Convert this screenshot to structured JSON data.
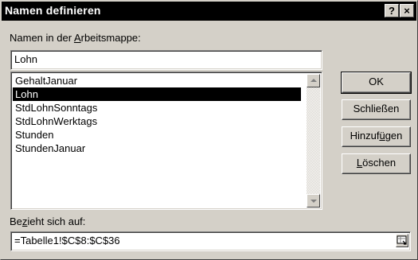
{
  "window": {
    "title": "Namen definieren",
    "help_button": "?",
    "close_button": "×"
  },
  "names_section": {
    "label_before": "Namen in der ",
    "label_accel": "A",
    "label_after": "rbeitsmappe:",
    "input_value": "Lohn",
    "items": [
      "GehaltJanuar",
      "Lohn",
      "StdLohnSonntags",
      "StdLohnWerktags",
      "Stunden",
      "StundenJanuar"
    ],
    "selected": "Lohn"
  },
  "buttons": {
    "ok": "OK",
    "close_before": "Schließen",
    "add_before": "Hinzuf",
    "add_accel": "ü",
    "add_after": "gen",
    "delete_accel": "L",
    "delete_after": "öschen"
  },
  "refers_section": {
    "label_before": "Be",
    "label_accel": "z",
    "label_after": "ieht sich auf:",
    "value": "=Tabelle1!$C$8:$C$36"
  },
  "colors": {
    "face": "#d4d0c8",
    "titlebar": "#000000",
    "selection": "#000000"
  }
}
